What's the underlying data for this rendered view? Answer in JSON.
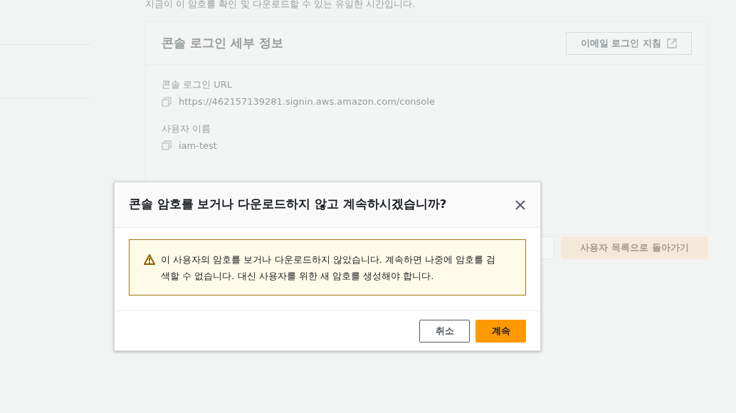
{
  "page": {
    "intro_text": "지금이 이 암호를 확인 및 다운로드할 수 있는 유일한 시간입니다.",
    "details_card": {
      "title": "콘솔 로그인 세부 정보",
      "email_button": "이메일 로그인 지침",
      "fields": [
        {
          "label": "콘솔 로그인 URL",
          "value": "https://462157139281.signin.aws.amazon.com/console"
        },
        {
          "label": "사용자 이름",
          "value": "iam-test"
        }
      ]
    },
    "return_button": "사용자 목록으로 돌아가기"
  },
  "dialog": {
    "title": "콘솔 암호를 보거나 다운로드하지 않고 계속하시겠습니까?",
    "warning": "이 사용자의 암호를 보거나 다운로드하지 않았습니다. 계속하면 나중에 암호를 검색할 수 없습니다. 대신 사용자를 위한 새 암호를 생성해야 합니다.",
    "buttons": [
      {
        "label": "취소",
        "kind": "secondary"
      },
      {
        "label": "계속",
        "kind": "primary"
      }
    ]
  }
}
